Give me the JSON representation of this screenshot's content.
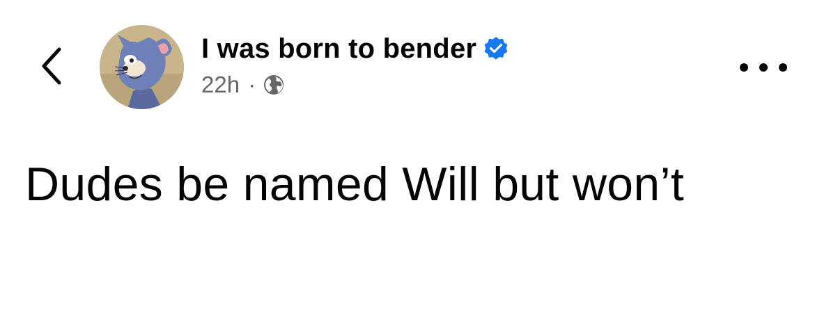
{
  "post": {
    "author_name": "I was born to bender",
    "verified": true,
    "timestamp": "22h",
    "separator": "·",
    "privacy": "globe-icon",
    "text": "Dudes be named Will but won’t"
  },
  "icons": {
    "back": "chevron-left-icon",
    "more": "more-horizontal-icon",
    "verified": "verified-badge-icon"
  },
  "colors": {
    "text_primary": "#050505",
    "text_secondary": "#65676b",
    "verified_blue": "#1877f2",
    "background": "#ffffff"
  }
}
